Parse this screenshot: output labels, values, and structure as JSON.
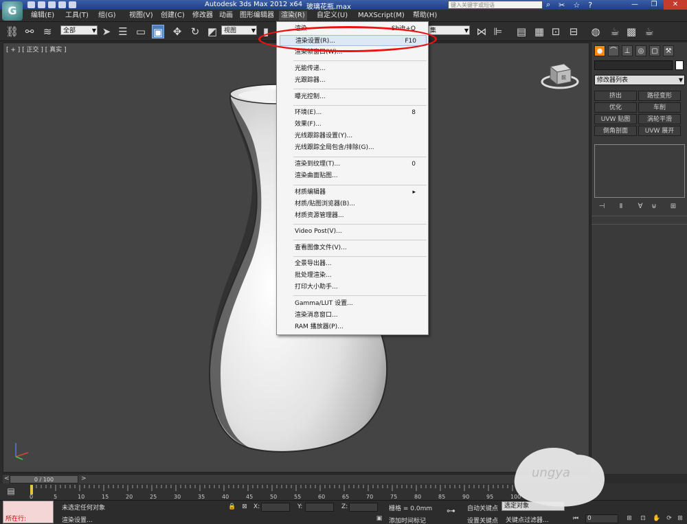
{
  "titlebar": {
    "app_title": "Autodesk 3ds Max  2012 x64",
    "file_name": "玻璃花瓶.max",
    "search_placeholder": "键入关键字或短语",
    "help_icon": "?",
    "minimize": "—",
    "restore": "❐",
    "close": "✕"
  },
  "app_logo": "G",
  "menubar": {
    "items": [
      "编辑(E)",
      "工具(T)",
      "组(G)",
      "视图(V)",
      "创建(C)",
      "修改器",
      "动画",
      "图形编辑器",
      "渲染(R)",
      "自定义(U)",
      "MAXScript(M)",
      "帮助(H)"
    ]
  },
  "toolbar": {
    "selection_filter": "全部",
    "ref_coord": "视图",
    "named_selection": "集"
  },
  "viewport": {
    "label": "[ + ] [ 正交 ] [ 真实 ]",
    "viewcube_label": "前"
  },
  "render_menu": {
    "items": [
      {
        "label": "渲染",
        "shortcut": "Shift+Q"
      },
      {
        "label": "渲染设置(R)...",
        "shortcut": "F10"
      },
      {
        "label": "渲染帧窗口(W)...",
        "shortcut": ""
      },
      {
        "label": "光能传递...",
        "shortcut": ""
      },
      {
        "label": "光跟踪器...",
        "shortcut": ""
      },
      {
        "label": "曝光控制...",
        "shortcut": ""
      },
      {
        "label": "环境(E)...",
        "shortcut": "8"
      },
      {
        "label": "效果(F)...",
        "shortcut": ""
      },
      {
        "label": "光线跟踪器设置(Y)...",
        "shortcut": ""
      },
      {
        "label": "光线跟踪全局包含/排除(G)...",
        "shortcut": ""
      },
      {
        "label": "渲染到纹理(T)...",
        "shortcut": "0"
      },
      {
        "label": "渲染曲面贴图...",
        "shortcut": ""
      },
      {
        "label": "材质编辑器",
        "shortcut": ""
      },
      {
        "label": "材质/贴图浏览器(B)...",
        "shortcut": ""
      },
      {
        "label": "材质资源管理器...",
        "shortcut": ""
      },
      {
        "label": "Video Post(V)...",
        "shortcut": ""
      },
      {
        "label": "查看图像文件(V)...",
        "shortcut": ""
      },
      {
        "label": "全景导出器...",
        "shortcut": ""
      },
      {
        "label": "批处理渲染...",
        "shortcut": ""
      },
      {
        "label": "打印大小助手...",
        "shortcut": ""
      },
      {
        "label": "Gamma/LUT 设置...",
        "shortcut": ""
      },
      {
        "label": "渲染消息窗口...",
        "shortcut": ""
      },
      {
        "label": "RAM 播放器(P)...",
        "shortcut": ""
      }
    ]
  },
  "command_panel": {
    "modifier_list": "修改器列表",
    "buttons": [
      "挤出",
      "路径变形",
      "优化",
      "车削",
      "UVW 贴图",
      "涡轮平滑",
      "倒角剖面",
      "UVW 展开"
    ]
  },
  "timeline": {
    "frame": "0 / 100",
    "prev": "<",
    "next": ">",
    "ticks": [
      "0",
      "5",
      "10",
      "15",
      "20",
      "25",
      "30",
      "35",
      "40",
      "45",
      "50",
      "55",
      "60",
      "65",
      "70",
      "75",
      "80",
      "85",
      "90",
      "95",
      "100"
    ]
  },
  "statusbar": {
    "script_label": "所在行:",
    "status_line1": "未选定任何对象",
    "status_line2": "渲染设置...",
    "x_label": "X:",
    "y_label": "Y:",
    "z_label": "Z:",
    "grid": "栅格 = 0.0mm",
    "add_time_tag": "添加时间标记",
    "auto_key": "自动关键点",
    "set_key": "设置关键点",
    "selected_object": "选定对象",
    "key_filters": "关键点过滤器...",
    "frame_field": "0"
  },
  "colors": {
    "accent": "#4d7fc0",
    "highlight_ellipse": "#ee1111",
    "menu_highlight": "#dde8f6",
    "titlebar": "#2a4b95"
  }
}
